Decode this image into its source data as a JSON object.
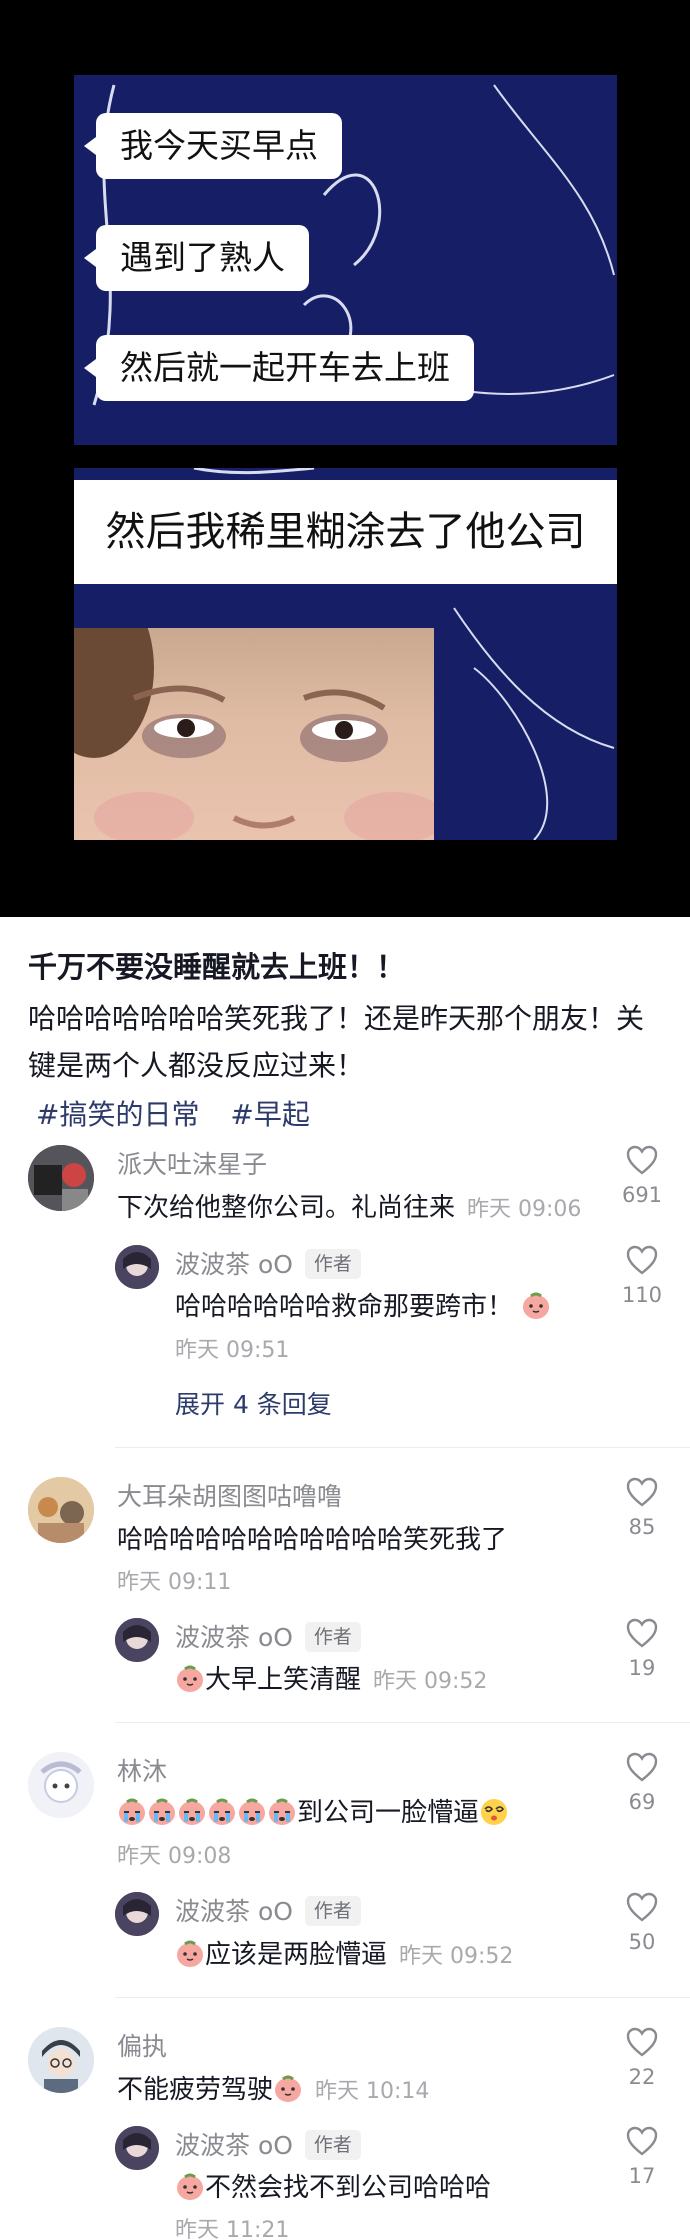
{
  "video": {
    "bubbles": [
      "我今天买早点",
      "遇到了熟人",
      "然后就一起开车去上班"
    ],
    "caption": "然后我稀里糊涂去了他公司",
    "background_color": "#161f66"
  },
  "post": {
    "title": "千万不要没睡醒就去上班！！",
    "body": "哈哈哈哈哈哈哈笑死我了！还是昨天那个朋友！关键是两个人都没反应过来！",
    "tags": [
      "#搞笑的日常",
      "#早起"
    ]
  },
  "comments": {
    "c1": {
      "user": "派大吐沫星子",
      "text": "下次给他整你公司。礼尚往来",
      "time": "昨天 09:06",
      "likes": "691"
    },
    "r1": {
      "user": "波波茶 oO",
      "badge": "作者",
      "text": "哈哈哈哈哈哈救命那要跨市！",
      "time": "昨天 09:51",
      "likes": "110"
    },
    "expand": "展开 4 条回复",
    "c2": {
      "user": "大耳朵胡图图咕噜噜",
      "text": "哈哈哈哈哈哈哈哈哈哈哈笑死我了",
      "time": "昨天 09:11",
      "likes": "85"
    },
    "r2": {
      "user": "波波茶 oO",
      "badge": "作者",
      "text": "大早上笑清醒",
      "time": "昨天 09:52",
      "likes": "19"
    },
    "c3": {
      "user": "林沐",
      "text": "到公司一脸懵逼",
      "time": "昨天 09:08",
      "likes": "69"
    },
    "r3": {
      "user": "波波茶 oO",
      "badge": "作者",
      "text": "应该是两脸懵逼",
      "time": "昨天 09:52",
      "likes": "50"
    },
    "c4": {
      "user": "偏执",
      "text": "不能疲劳驾驶",
      "time": "昨天 10:14",
      "likes": "22"
    },
    "r4": {
      "user": "波波茶 oO",
      "badge": "作者",
      "text": "不然会找不到公司哈哈哈",
      "time": "昨天 11:21",
      "likes": "17"
    }
  },
  "icons": {
    "like": "heart-outline-icon",
    "emoji": "peach-emoji-icon",
    "crying": "crying-emoji-icon",
    "dizzy": "dizzy-emoji-icon"
  }
}
